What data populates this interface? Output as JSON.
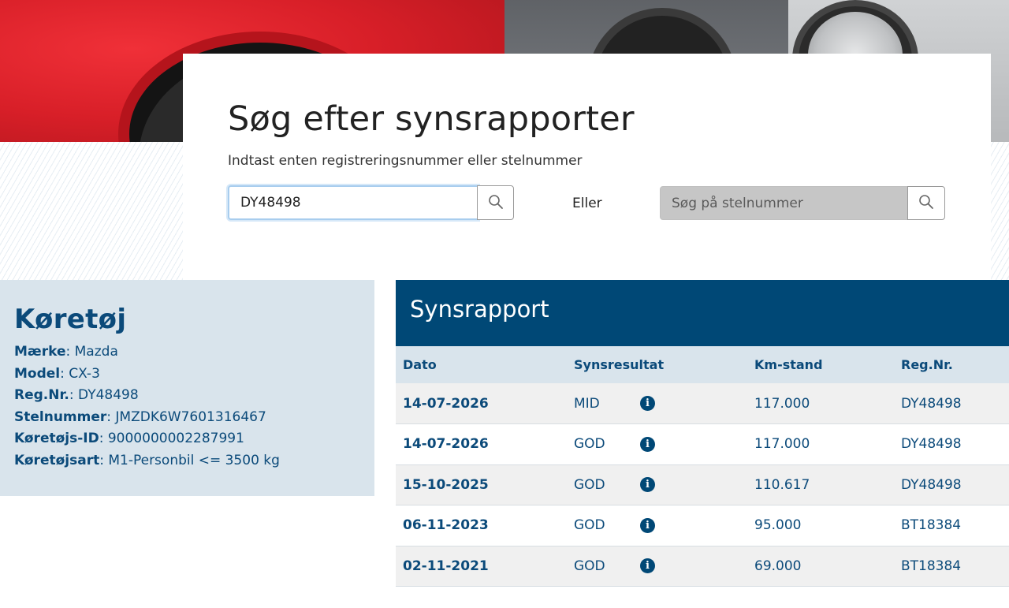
{
  "search": {
    "title": "Søg efter synsrapporter",
    "subtitle": "Indtast enten registreringsnummer eller stelnummer",
    "reg_value": "DY48498",
    "or_label": "Eller",
    "vin_placeholder": "Søg på stelnummer"
  },
  "vehicle": {
    "title": "Køretøj",
    "fields": [
      {
        "label": "Mærke",
        "value": "Mazda"
      },
      {
        "label": "Model",
        "value": "CX-3"
      },
      {
        "label": "Reg.Nr.",
        "value": "DY48498"
      },
      {
        "label": "Stelnummer",
        "value": "JMZDK6W7601316467"
      },
      {
        "label": "Køretøjs-ID",
        "value": "9000000002287991"
      },
      {
        "label": "Køretøjsart",
        "value": "M1-Personbil <= 3500 kg"
      }
    ]
  },
  "report": {
    "title": "Synsrapport",
    "columns": [
      "Dato",
      "Synsresultat",
      "Km-stand",
      "Reg.Nr."
    ],
    "rows": [
      {
        "date": "14-07-2026",
        "result": "MID",
        "km": "117.000",
        "reg": "DY48498"
      },
      {
        "date": "14-07-2026",
        "result": "GOD",
        "km": "117.000",
        "reg": "DY48498"
      },
      {
        "date": "15-10-2025",
        "result": "GOD",
        "km": "110.617",
        "reg": "DY48498"
      },
      {
        "date": "06-11-2023",
        "result": "GOD",
        "km": "95.000",
        "reg": "BT18384"
      },
      {
        "date": "02-11-2021",
        "result": "GOD",
        "km": "69.000",
        "reg": "BT18384"
      }
    ],
    "info_glyph": "i"
  },
  "icons": {
    "search": "search-icon",
    "info": "info-icon"
  },
  "colors": {
    "brand_dark": "#004876",
    "panel_light": "#d9e4ec",
    "text_blue": "#0b4a7a"
  }
}
